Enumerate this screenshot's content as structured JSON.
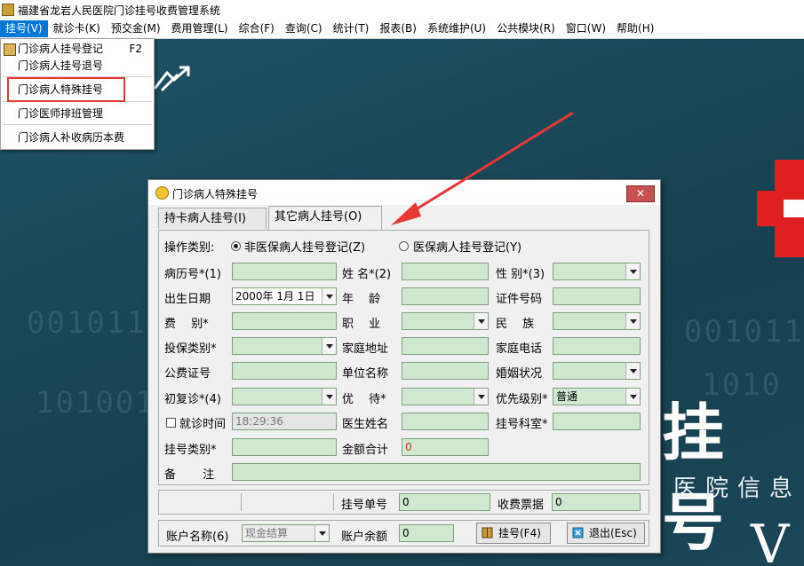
{
  "window": {
    "title": "福建省龙岩人民医院门诊挂号收费管理系统"
  },
  "menu": [
    {
      "label": "挂号(V)"
    },
    {
      "label": "就诊卡(K)"
    },
    {
      "label": "预交金(M)"
    },
    {
      "label": "费用管理(L)"
    },
    {
      "label": "综合(F)"
    },
    {
      "label": "查询(C)"
    },
    {
      "label": "统计(T)"
    },
    {
      "label": "报表(B)"
    },
    {
      "label": "系统维护(U)"
    },
    {
      "label": "公共模块(R)"
    },
    {
      "label": "窗口(W)"
    },
    {
      "label": "帮助(H)"
    }
  ],
  "dropdown": {
    "items": [
      {
        "label": "门诊病人挂号登记",
        "shortcut": "F2"
      },
      {
        "label": "门诊病人挂号退号"
      },
      {
        "label": "门诊病人特殊挂号"
      },
      {
        "label": "门诊医师排班管理"
      },
      {
        "label": "门诊病人补收病历本费"
      }
    ]
  },
  "background": {
    "big_text": "挂 号",
    "sub_text": "医院信息",
    "version_letter": "V",
    "binary": [
      "001011",
      "101001",
      "0010110",
      "1010"
    ]
  },
  "dialog": {
    "title": "门诊病人特殊挂号",
    "close_label": "✕",
    "tabs": [
      {
        "label": "持卡病人挂号(I)"
      },
      {
        "label": "其它病人挂号(O)"
      }
    ],
    "op_type_label": "操作类别:",
    "op_options": [
      {
        "label": "非医保病人挂号登记(Z)"
      },
      {
        "label": "医保病人挂号登记(Y)"
      }
    ],
    "fields": {
      "record_no": {
        "label": "病历号*(1)",
        "value": ""
      },
      "name": {
        "label": "姓 名*(2)",
        "value": ""
      },
      "gender": {
        "label": "性 别*(3)",
        "value": ""
      },
      "birth": {
        "label": "出生日期",
        "value": "2000年 1月 1日"
      },
      "age": {
        "label": "年　 龄",
        "value": ""
      },
      "id_no": {
        "label": "证件号码",
        "value": ""
      },
      "fee_type": {
        "label": "费　 别*",
        "value": ""
      },
      "job": {
        "label": "职　 业",
        "value": ""
      },
      "ethnic": {
        "label": "民　 族",
        "value": ""
      },
      "ins_type": {
        "label": "投保类别*",
        "value": ""
      },
      "address": {
        "label": "家庭地址",
        "value": ""
      },
      "phone": {
        "label": "家庭电话",
        "value": ""
      },
      "public_no": {
        "label": "公费证号",
        "value": ""
      },
      "company": {
        "label": "单位名称",
        "value": ""
      },
      "marriage": {
        "label": "婚姻状况",
        "value": ""
      },
      "revisit": {
        "label": "初复诊*(4)",
        "value": ""
      },
      "treatment": {
        "label": "优　 待*",
        "value": ""
      },
      "priority": {
        "label": "优先级别*",
        "value": "普通"
      },
      "visit_time": {
        "label": "就诊时间",
        "value": "18:29:36"
      },
      "doctor": {
        "label": "医生姓名",
        "value": ""
      },
      "dept": {
        "label": "挂号科室*",
        "value": ""
      },
      "reg_type": {
        "label": "挂号类别*",
        "value": ""
      },
      "amount": {
        "label": "金额合计",
        "value": "0"
      },
      "note": {
        "label": "备　　 注",
        "value": ""
      }
    },
    "status": {
      "reg_no_label": "挂号单号",
      "reg_no": "0",
      "receipt_label": "收费票据",
      "receipt": "0"
    },
    "bottom": {
      "account_label": "账户名称(6)",
      "account_value": "现金结算",
      "balance_label": "账户余额",
      "balance": "0",
      "register_btn": "挂号(F4)",
      "exit_btn": "退出(Esc)"
    }
  },
  "colors": {
    "field_bg": "#cfe8cf",
    "menu_active": "#0078d7",
    "highlight": "#e53935",
    "close_btn": "#c75050"
  }
}
